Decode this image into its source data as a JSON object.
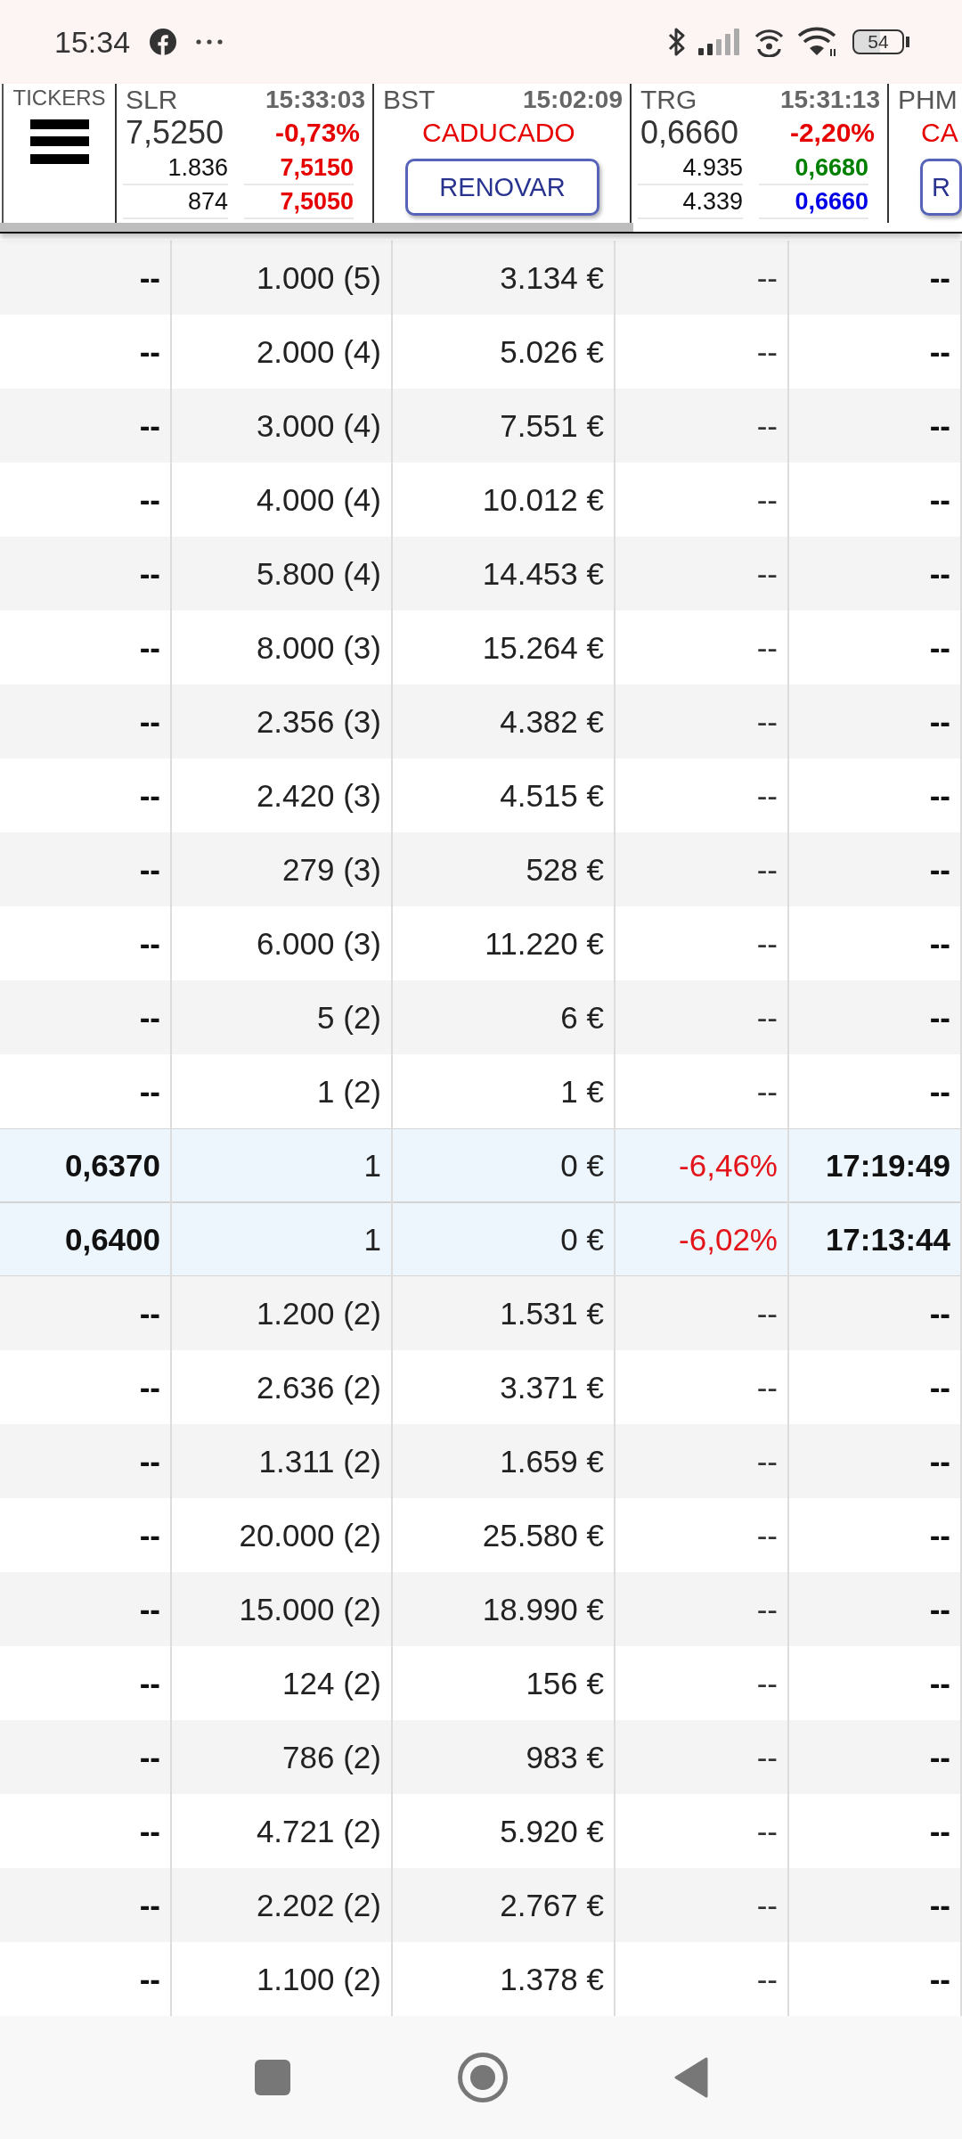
{
  "status_bar": {
    "time": "15:34",
    "battery": "54"
  },
  "ticker_bar": {
    "label": "TICKERS",
    "tickers": [
      {
        "kind": "quote",
        "symbol": "SLR",
        "time": "15:33:03",
        "price": "7,5250",
        "change": "-0,73%",
        "book": [
          {
            "volume": "1.836",
            "price": "7,5150",
            "color": "#e60000"
          },
          {
            "volume": "874",
            "price": "7,5050",
            "color": "#e60000"
          }
        ]
      },
      {
        "kind": "expired",
        "symbol": "BST",
        "time": "15:02:09",
        "status": "CADUCADO",
        "button": "RENOVAR"
      },
      {
        "kind": "quote",
        "symbol": "TRG",
        "time": "15:31:13",
        "price": "0,6660",
        "change": "-2,20%",
        "book": [
          {
            "volume": "4.935",
            "price": "0,6680",
            "color": "#008000"
          },
          {
            "volume": "4.339",
            "price": "0,6660",
            "color": "#0000e6"
          }
        ]
      },
      {
        "kind": "expired",
        "symbol": "PHM",
        "status": "CA",
        "button": "R"
      }
    ]
  },
  "table": {
    "rows": [
      {
        "cells": [
          "--",
          "1.000 (5)",
          "3.134 €",
          "--",
          "--"
        ],
        "highlighted": false
      },
      {
        "cells": [
          "--",
          "2.000 (4)",
          "5.026 €",
          "--",
          "--"
        ],
        "highlighted": false
      },
      {
        "cells": [
          "--",
          "3.000 (4)",
          "7.551 €",
          "--",
          "--"
        ],
        "highlighted": false
      },
      {
        "cells": [
          "--",
          "4.000 (4)",
          "10.012 €",
          "--",
          "--"
        ],
        "highlighted": false
      },
      {
        "cells": [
          "--",
          "5.800 (4)",
          "14.453 €",
          "--",
          "--"
        ],
        "highlighted": false
      },
      {
        "cells": [
          "--",
          "8.000 (3)",
          "15.264 €",
          "--",
          "--"
        ],
        "highlighted": false
      },
      {
        "cells": [
          "--",
          "2.356 (3)",
          "4.382 €",
          "--",
          "--"
        ],
        "highlighted": false
      },
      {
        "cells": [
          "--",
          "2.420 (3)",
          "4.515 €",
          "--",
          "--"
        ],
        "highlighted": false
      },
      {
        "cells": [
          "--",
          "279 (3)",
          "528 €",
          "--",
          "--"
        ],
        "highlighted": false
      },
      {
        "cells": [
          "--",
          "6.000 (3)",
          "11.220 €",
          "--",
          "--"
        ],
        "highlighted": false
      },
      {
        "cells": [
          "--",
          "5 (2)",
          "6 €",
          "--",
          "--"
        ],
        "highlighted": false
      },
      {
        "cells": [
          "--",
          "1 (2)",
          "1 €",
          "--",
          "--"
        ],
        "highlighted": false
      },
      {
        "cells": [
          "0,6370",
          "1",
          "0 €",
          "-6,46%",
          "17:19:49"
        ],
        "highlighted": true
      },
      {
        "cells": [
          "0,6400",
          "1",
          "0 €",
          "-6,02%",
          "17:13:44"
        ],
        "highlighted": true
      },
      {
        "cells": [
          "--",
          "1.200 (2)",
          "1.531 €",
          "--",
          "--"
        ],
        "highlighted": false
      },
      {
        "cells": [
          "--",
          "2.636 (2)",
          "3.371 €",
          "--",
          "--"
        ],
        "highlighted": false
      },
      {
        "cells": [
          "--",
          "1.311 (2)",
          "1.659 €",
          "--",
          "--"
        ],
        "highlighted": false
      },
      {
        "cells": [
          "--",
          "20.000 (2)",
          "25.580 €",
          "--",
          "--"
        ],
        "highlighted": false
      },
      {
        "cells": [
          "--",
          "15.000 (2)",
          "18.990 €",
          "--",
          "--"
        ],
        "highlighted": false
      },
      {
        "cells": [
          "--",
          "124 (2)",
          "156 €",
          "--",
          "--"
        ],
        "highlighted": false
      },
      {
        "cells": [
          "--",
          "786 (2)",
          "983 €",
          "--",
          "--"
        ],
        "highlighted": false
      },
      {
        "cells": [
          "--",
          "4.721 (2)",
          "5.920 €",
          "--",
          "--"
        ],
        "highlighted": false
      },
      {
        "cells": [
          "--",
          "2.202 (2)",
          "2.767 €",
          "--",
          "--"
        ],
        "highlighted": false
      },
      {
        "cells": [
          "--",
          "1.100 (2)",
          "1.378 €",
          "--",
          "--"
        ],
        "highlighted": false
      }
    ]
  }
}
